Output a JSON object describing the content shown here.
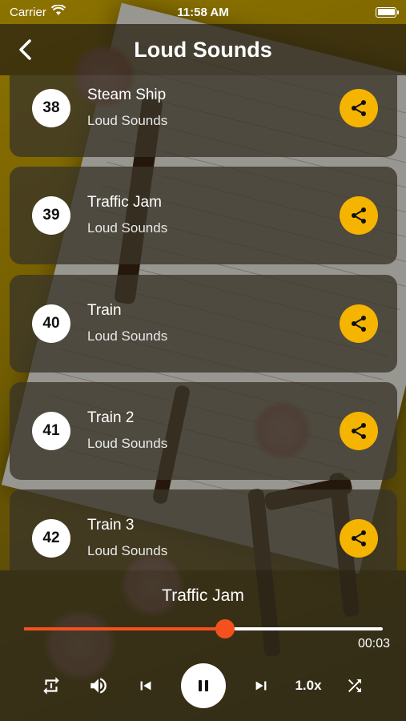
{
  "status_bar": {
    "carrier": "Carrier",
    "time": "11:58 AM"
  },
  "header": {
    "title": "Loud Sounds",
    "back_icon": "chevron-left-icon"
  },
  "sounds": [
    {
      "number": "38",
      "name": "Steam Ship",
      "category": "Loud Sounds"
    },
    {
      "number": "39",
      "name": "Traffic Jam",
      "category": "Loud Sounds"
    },
    {
      "number": "40",
      "name": "Train",
      "category": "Loud Sounds"
    },
    {
      "number": "41",
      "name": "Train 2",
      "category": "Loud Sounds"
    },
    {
      "number": "42",
      "name": "Train 3",
      "category": "Loud Sounds"
    }
  ],
  "player": {
    "now_playing": "Traffic Jam",
    "elapsed": "00:03",
    "progress_fraction": 0.56,
    "speed": "1.0x",
    "controls": [
      "repeat-icon",
      "volume-icon",
      "previous-icon",
      "pause-icon",
      "next-icon",
      "speed",
      "shuffle-icon"
    ]
  },
  "colors": {
    "accent": "#f5b400",
    "progress": "#f4511e",
    "card": "#3a3428"
  }
}
